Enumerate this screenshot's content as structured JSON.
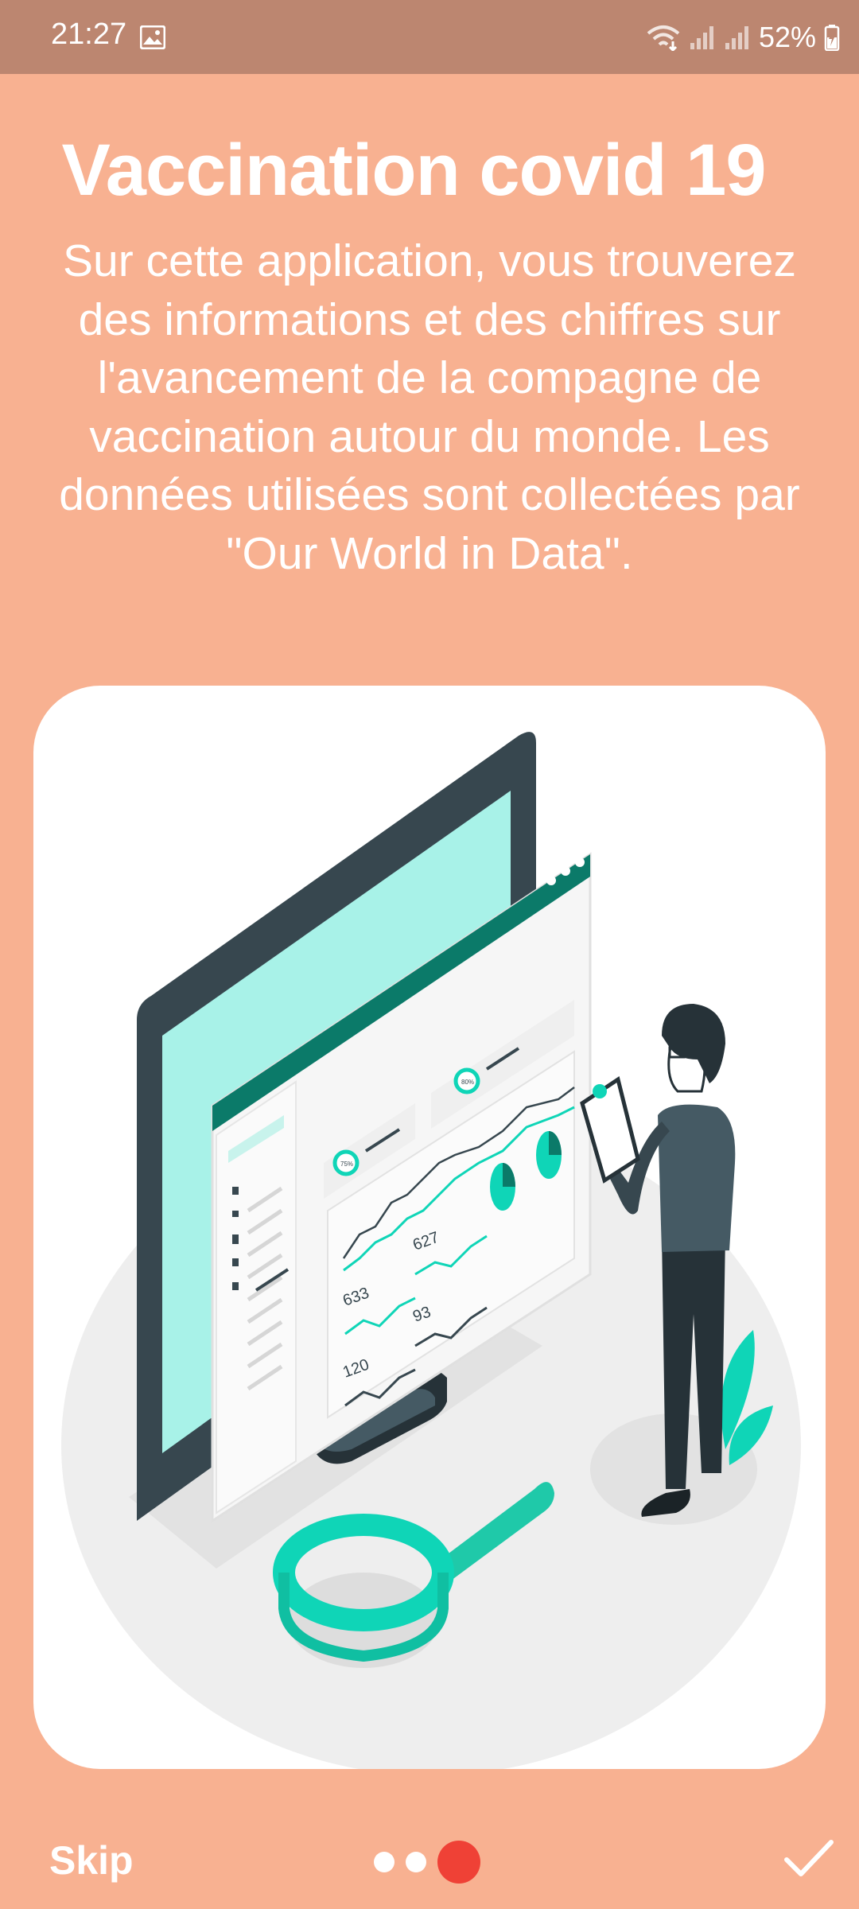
{
  "status_bar": {
    "time": "21:27",
    "battery": "52%",
    "icons": [
      "gallery-icon",
      "wifi-icon",
      "signal-icon",
      "signal-icon",
      "battery-icon"
    ]
  },
  "onboarding": {
    "title": "Vaccination covid 19",
    "description": "Sur cette application, vous trouverez des informations et des chiffres sur l'avancement de la compagne de vaccination autour du monde. Les données utilisées sont collectées par \"Our World in Data\".",
    "illustration": {
      "numbers": [
        "633",
        "627",
        "93",
        "120"
      ],
      "badges": [
        "75%",
        "80%"
      ]
    }
  },
  "bottom_bar": {
    "skip_label": "Skip",
    "page_count": 3,
    "active_page": 3
  },
  "colors": {
    "background": "#F8B191",
    "status_bar": "#BC8670",
    "accent": "#EF4136",
    "teal": "#0FD5B7"
  }
}
